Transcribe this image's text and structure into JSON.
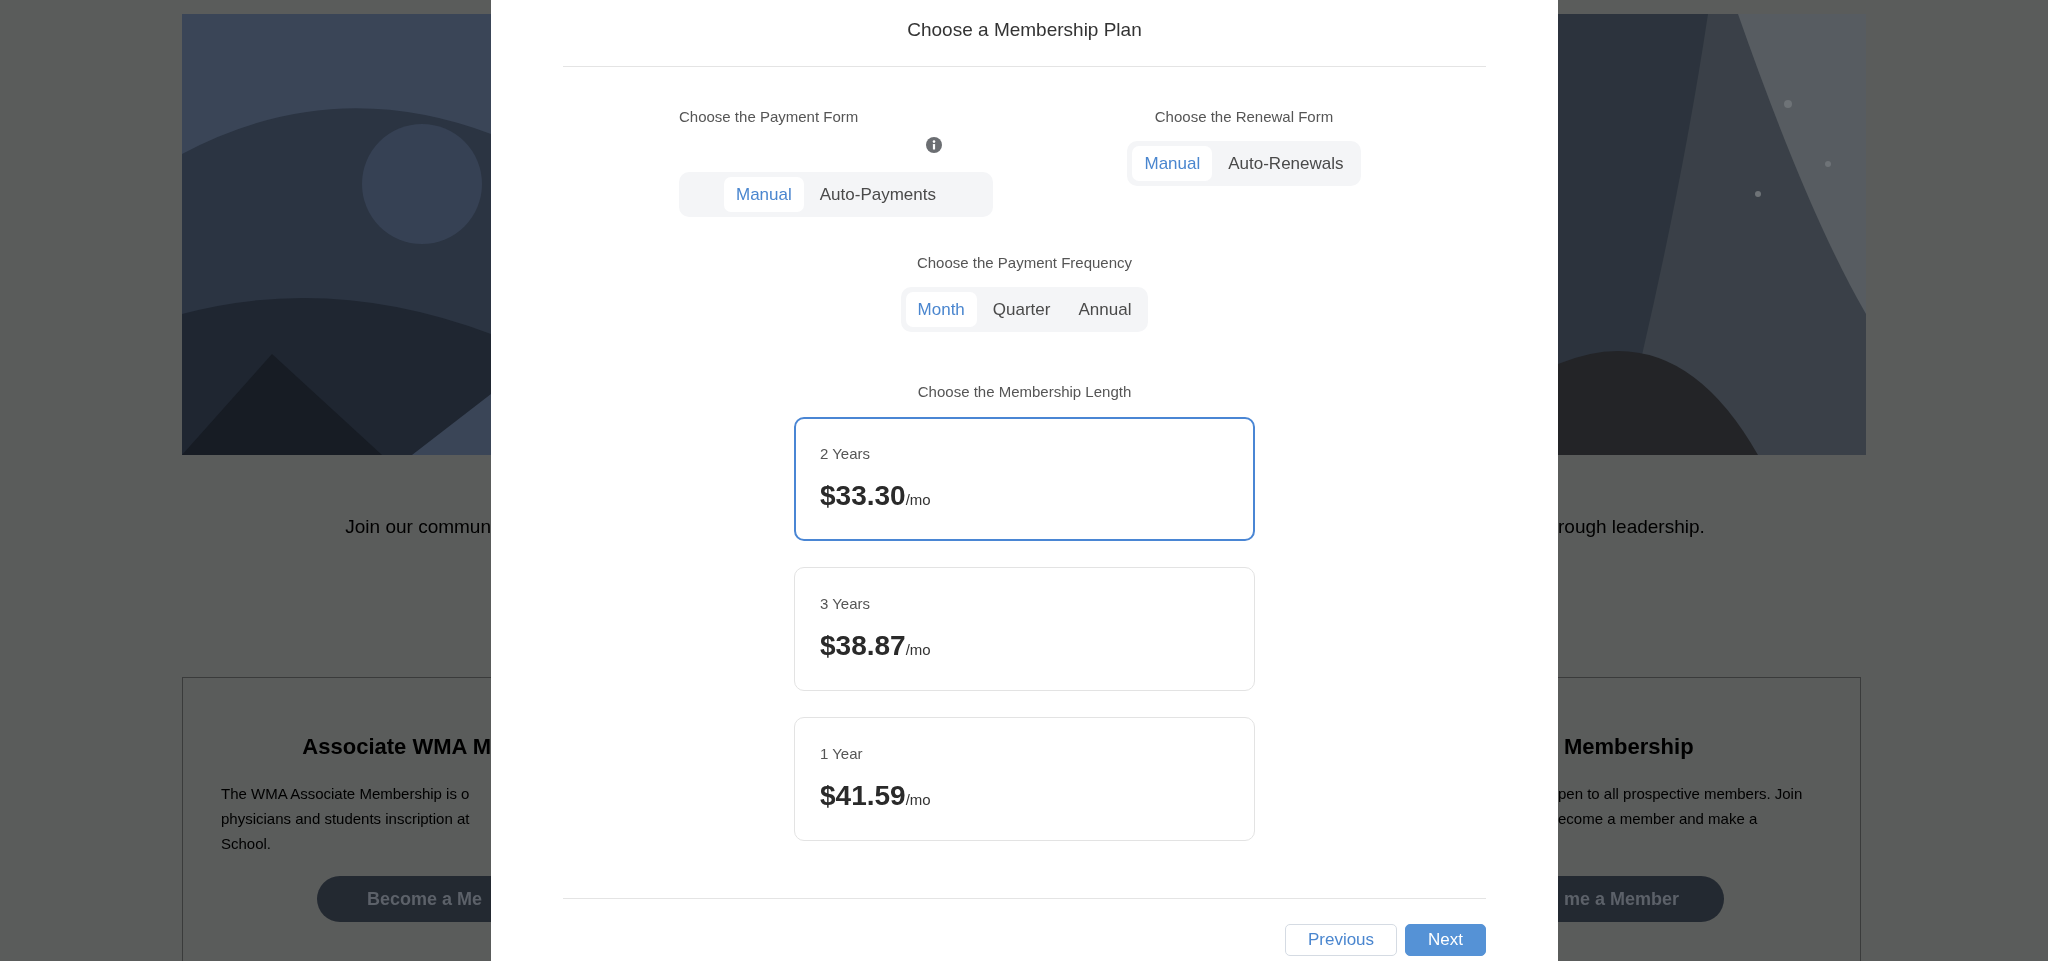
{
  "background": {
    "intro_left": "Join our commun",
    "intro_right": "rough leadership.",
    "left_card": {
      "title": "Associate WMA M",
      "lines": [
        "The WMA Associate Membership is o",
        "physicians and students inscription at",
        "School."
      ],
      "button": "Become a Me"
    },
    "right_card": {
      "title": "Membership",
      "lines": [
        "pen to all prospective members. Join",
        "ecome a member and make a"
      ],
      "button": "me a Member"
    }
  },
  "modal": {
    "title": "Choose a Membership Plan",
    "payment_form": {
      "label": "Choose the Payment Form",
      "options": [
        {
          "label": "Manual",
          "selected": true
        },
        {
          "label": "Auto-Payments",
          "selected": false
        }
      ]
    },
    "renewal_form": {
      "label": "Choose the Renewal Form",
      "options": [
        {
          "label": "Manual",
          "selected": true
        },
        {
          "label": "Auto-Renewals",
          "selected": false
        }
      ]
    },
    "payment_frequency": {
      "label": "Choose the Payment Frequency",
      "options": [
        {
          "label": "Month",
          "selected": true
        },
        {
          "label": "Quarter",
          "selected": false
        },
        {
          "label": "Annual",
          "selected": false
        }
      ]
    },
    "membership_length": {
      "label": "Choose the Membership Length",
      "plans": [
        {
          "name": "2 Years",
          "price": "$33.30",
          "unit": "/mo",
          "selected": true
        },
        {
          "name": "3 Years",
          "price": "$38.87",
          "unit": "/mo",
          "selected": false
        },
        {
          "name": "1 Year",
          "price": "$41.59",
          "unit": "/mo",
          "selected": false
        }
      ]
    },
    "buttons": [
      {
        "label": "Previous",
        "kind": "secondary"
      },
      {
        "label": "Next",
        "kind": "primary"
      }
    ]
  }
}
